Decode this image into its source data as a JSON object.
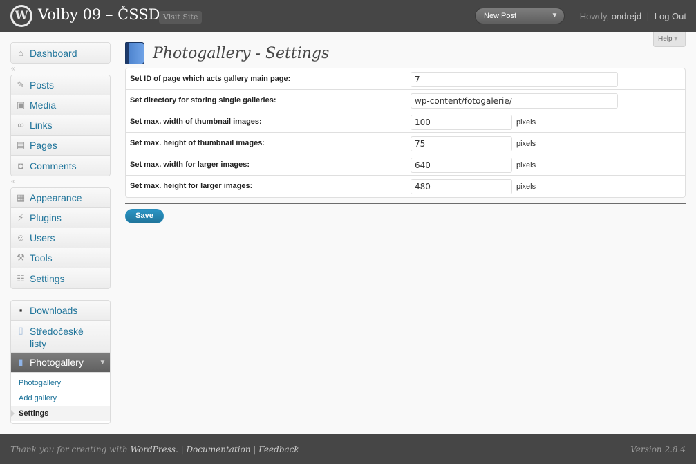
{
  "header": {
    "site_title": "Volby 09 – ČSSD",
    "visit_site": "Visit Site",
    "favorite_action": "New Post",
    "howdy": "Howdy,",
    "username": "ondrejd",
    "separator": "|",
    "logout": "Log Out"
  },
  "help_tab": "Help",
  "menu": {
    "dashboard": "Dashboard",
    "posts": "Posts",
    "media": "Media",
    "links": "Links",
    "pages": "Pages",
    "comments": "Comments",
    "appearance": "Appearance",
    "plugins": "Plugins",
    "users": "Users",
    "tools": "Tools",
    "settings": "Settings",
    "downloads": "Downloads",
    "stredoceske_line1": "Středočeské",
    "stredoceske_line2": "listy",
    "photogallery": "Photogallery",
    "submenu": [
      "Photogallery",
      "Add gallery",
      "Settings"
    ]
  },
  "page": {
    "title": "Photogallery - Settings"
  },
  "settings": [
    {
      "label": "Set ID of page which acts gallery main page:",
      "value": "7",
      "unit": ""
    },
    {
      "label": "Set directory for storing single galleries:",
      "value": "wp-content/fotogalerie/",
      "unit": ""
    },
    {
      "label": "Set max. width of thumbnail images:",
      "value": "100",
      "unit": "pixels"
    },
    {
      "label": "Set max. height of thumbnail images:",
      "value": "75",
      "unit": "pixels"
    },
    {
      "label": "Set max. width for larger images:",
      "value": "640",
      "unit": "pixels"
    },
    {
      "label": "Set max. height for larger images:",
      "value": "480",
      "unit": "pixels"
    }
  ],
  "save_label": "Save",
  "footer": {
    "thanks": "Thank you for creating with",
    "wordpress": "WordPress.",
    "sep": "|",
    "documentation": "Documentation",
    "feedback": "Feedback",
    "version": "Version 2.8.4"
  },
  "colors": {
    "header_bg": "#464646",
    "link": "#21759b",
    "button": "#21759b"
  }
}
